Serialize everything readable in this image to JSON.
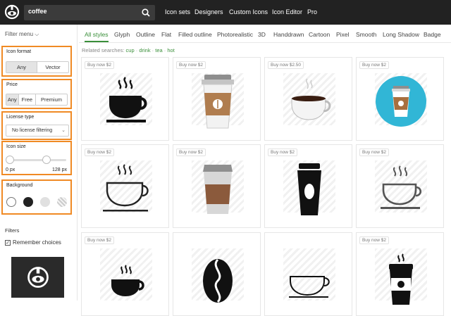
{
  "header": {
    "logo_icon": "iconfinder-logo",
    "search": {
      "value": "coffee",
      "icon": "search-icon"
    },
    "nav": [
      "Icon sets",
      "Designers",
      "Custom Icons",
      "Icon Editor",
      "Pro"
    ]
  },
  "sidebar": {
    "filter_menu": "Filter menu",
    "icon_format": {
      "title": "Icon format",
      "options": [
        "Any",
        "Vector"
      ],
      "selected": "Any"
    },
    "price": {
      "title": "Price",
      "options": [
        "Any",
        "Free",
        "Premium"
      ],
      "selected": "Any"
    },
    "license": {
      "title": "License type",
      "value": "No license filtering"
    },
    "size": {
      "title": "Icon size",
      "min_label": "0 px",
      "max_label": "128 px"
    },
    "background": {
      "title": "Background",
      "swatches": [
        "white",
        "black",
        "light-gray",
        "transparent"
      ],
      "selected": "white"
    },
    "filters_title": "Filters",
    "remember": {
      "label": "Remember choices",
      "checked": true
    }
  },
  "tabs": [
    "All styles",
    "Glyph",
    "Outline",
    "Flat",
    "Filled outline",
    "Photorealistic",
    "3D",
    "Handdrawn",
    "Cartoon",
    "Pixel",
    "Smooth",
    "Long Shadow",
    "Badge"
  ],
  "active_tab": "All styles",
  "related": {
    "label": "Related searches:",
    "terms": [
      "cup",
      "drink",
      "tea",
      "hot"
    ]
  },
  "icons": [
    {
      "price": "Buy now $2",
      "icon": "steaming-coffee-cup-glyph-icon"
    },
    {
      "price": "Buy now $2",
      "icon": "takeaway-coffee-cup-flat-icon"
    },
    {
      "price": "Buy now $2.50",
      "icon": "coffee-cup-realistic-icon"
    },
    {
      "price": "Buy now $2",
      "icon": "takeaway-cup-badge-icon"
    },
    {
      "price": "Buy now $2",
      "icon": "coffee-cup-outline-icon"
    },
    {
      "price": "Buy now $2",
      "icon": "paper-coffee-cup-flat-icon"
    },
    {
      "price": "Buy now $2",
      "icon": "takeaway-cup-glyph-icon"
    },
    {
      "price": "Buy now $2",
      "icon": "coffee-cup-gray-outline-icon"
    },
    {
      "price": "Buy now $2",
      "icon": "coffee-cup-small-glyph-icon"
    },
    {
      "price": "",
      "icon": "coffee-bean-icon"
    },
    {
      "price": "",
      "icon": "coffee-cup-thin-outline-icon"
    },
    {
      "price": "Buy now $2",
      "icon": "hot-takeaway-cup-glyph-icon"
    }
  ]
}
